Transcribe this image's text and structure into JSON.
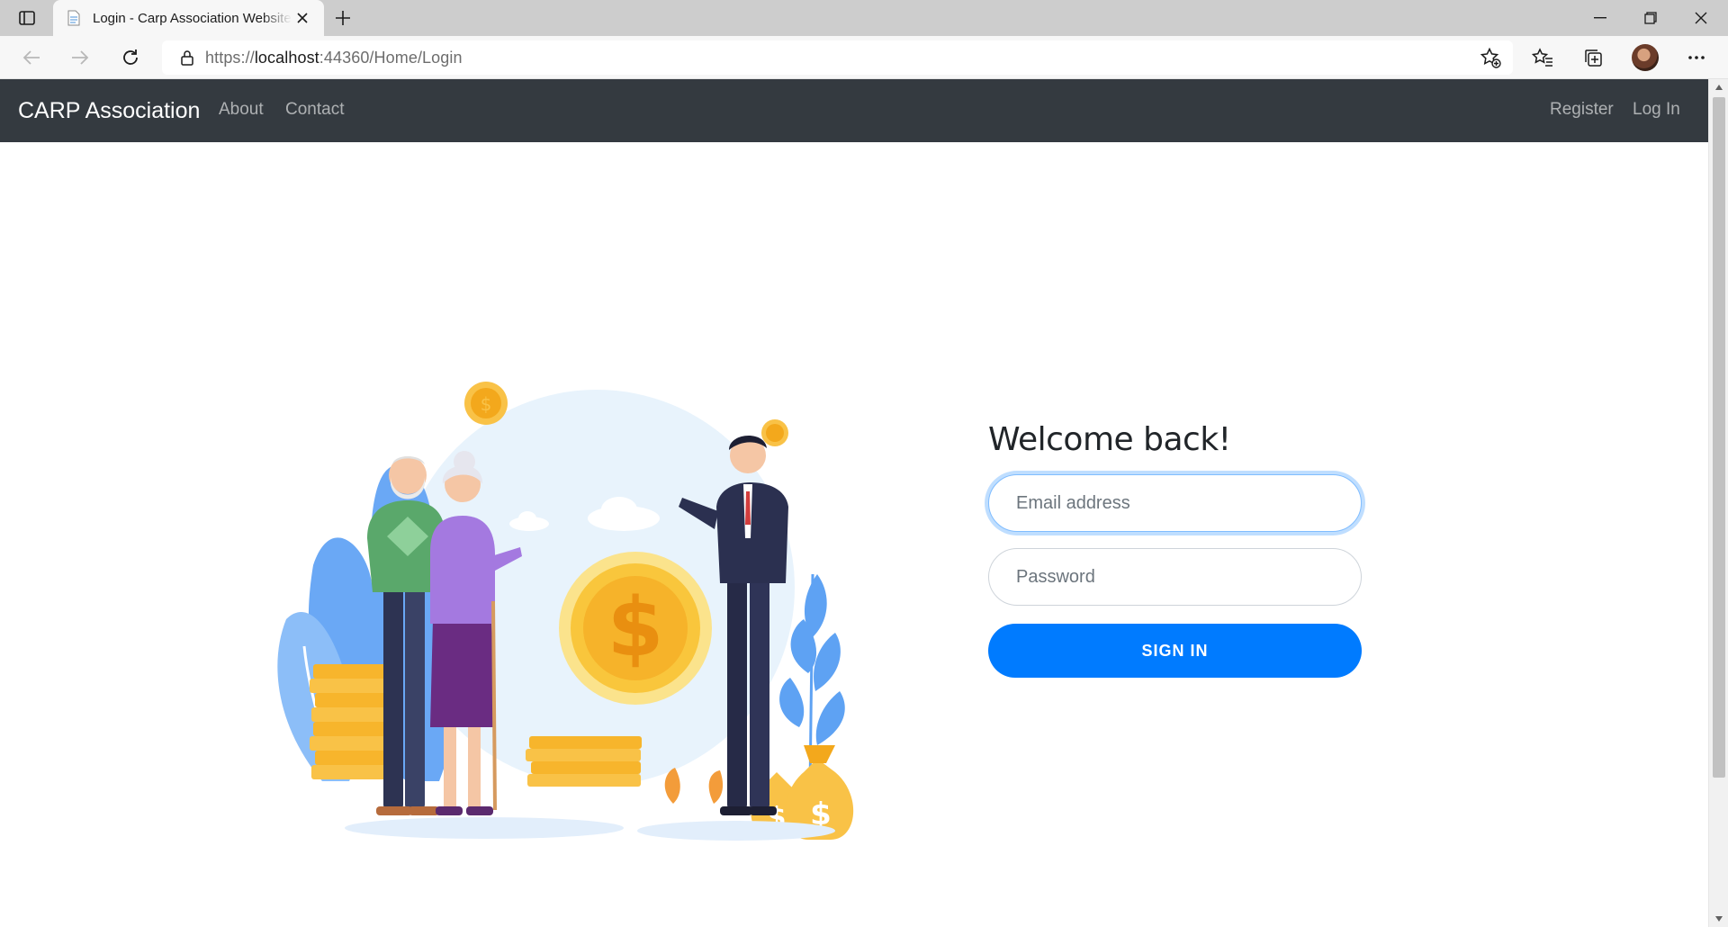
{
  "browser": {
    "tab_title": "Login - Carp Association Website",
    "url_protocol": "https://",
    "url_host": "localhost",
    "url_path": ":44360/Home/Login"
  },
  "navbar": {
    "brand": "CARP Association",
    "links": [
      {
        "label": "About"
      },
      {
        "label": "Contact"
      }
    ],
    "right_links": [
      {
        "label": "Register"
      },
      {
        "label": "Log In"
      }
    ],
    "background": "#343a40"
  },
  "login": {
    "heading": "Welcome back!",
    "email_placeholder": "Email address",
    "password_placeholder": "Password",
    "submit_label": "SIGN IN",
    "accent": "#007bff"
  },
  "icons": {
    "tab_actions": "tab-actions-icon",
    "favicon": "page-icon",
    "close": "close-icon",
    "new_tab": "plus-icon",
    "back": "back-arrow-icon",
    "forward": "forward-arrow-icon",
    "refresh": "refresh-icon",
    "lock": "lock-icon",
    "add_favorite": "star-plus-icon",
    "favorites": "favorites-icon",
    "collections": "collections-icon",
    "profile": "avatar",
    "more": "ellipsis-icon"
  }
}
